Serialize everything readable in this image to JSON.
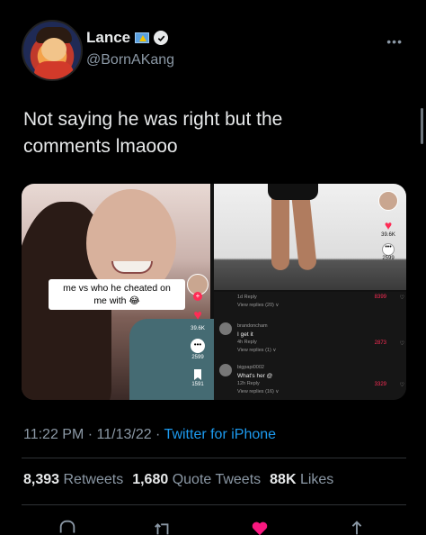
{
  "author": {
    "name": "Lance",
    "handle": "@BornAKang"
  },
  "tweet": {
    "text": "Not saying he was right but the\ncomments lmaooo"
  },
  "media": {
    "left": {
      "caption": "me vs who he cheated on\nme with 😂",
      "likes": "39.6K",
      "comments": "2599",
      "saves": "1591"
    },
    "right_top": {
      "likes": "39.6K",
      "comments": "2599"
    },
    "comments": [
      {
        "meta": "1d  Reply",
        "likes": "8399",
        "replies": "View replies (20) ∨"
      },
      {
        "user": "brandoncham",
        "text": "I get it",
        "meta": "4h  Reply",
        "likes": "2873",
        "replies": "View replies (1) ∨"
      },
      {
        "user": "bigpapi0002",
        "text": "What's her @",
        "meta": "12h  Reply",
        "likes": "3329",
        "replies": "View replies (16) ∨"
      }
    ]
  },
  "meta": {
    "time": "11:22 PM · 11/13/22 · ",
    "source": "Twitter for iPhone"
  },
  "stats": {
    "retweets_count": "8,393",
    "retweets_label": "Retweets",
    "quotes_count": "1,680",
    "quotes_label": "Quote Tweets",
    "likes_count": "88K",
    "likes_label": "Likes"
  },
  "colors": {
    "accent": "#1d9bf0",
    "like": "#f91880",
    "tiktok_red": "#fe2c55",
    "muted": "#8b98a5"
  },
  "icons": [
    "verified-icon",
    "more-icon",
    "reply-icon",
    "retweet-icon",
    "heart-icon",
    "share-icon"
  ]
}
